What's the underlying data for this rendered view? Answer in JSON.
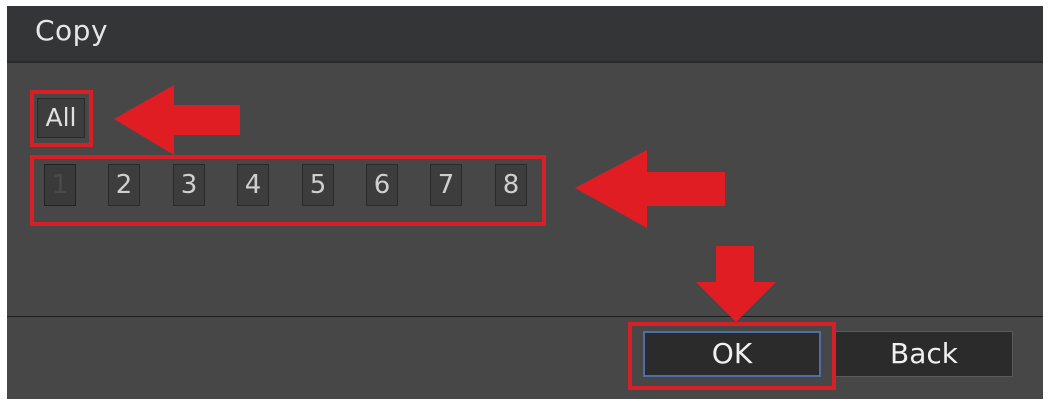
{
  "dialog": {
    "title": "Copy",
    "all_label": "All",
    "channels": [
      "1",
      "2",
      "3",
      "4",
      "5",
      "6",
      "7",
      "8"
    ],
    "ok_label": "OK",
    "back_label": "Back"
  },
  "colors": {
    "annotation": "#d61f26",
    "panel": "#474747",
    "titlebar": "#333537",
    "ok_border": "#4d6fa5"
  }
}
